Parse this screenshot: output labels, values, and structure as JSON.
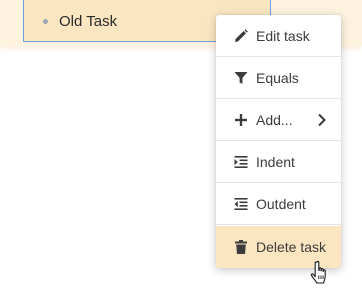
{
  "task": {
    "name": "Old Task"
  },
  "menu": {
    "items": [
      {
        "label": "Edit task",
        "icon": "pencil-icon"
      },
      {
        "label": "Equals",
        "icon": "filter-icon"
      },
      {
        "label": "Add...",
        "icon": "plus-icon",
        "submenu": true
      },
      {
        "label": "Indent",
        "icon": "indent-icon"
      },
      {
        "label": "Outdent",
        "icon": "outdent-icon"
      },
      {
        "label": "Delete task",
        "icon": "trash-icon",
        "hovered": true
      }
    ]
  },
  "colors": {
    "highlight": "#fbe6c1",
    "band": "#fdf3df",
    "selection_border": "#6f9ee0",
    "icon": "#3c3c3c"
  }
}
